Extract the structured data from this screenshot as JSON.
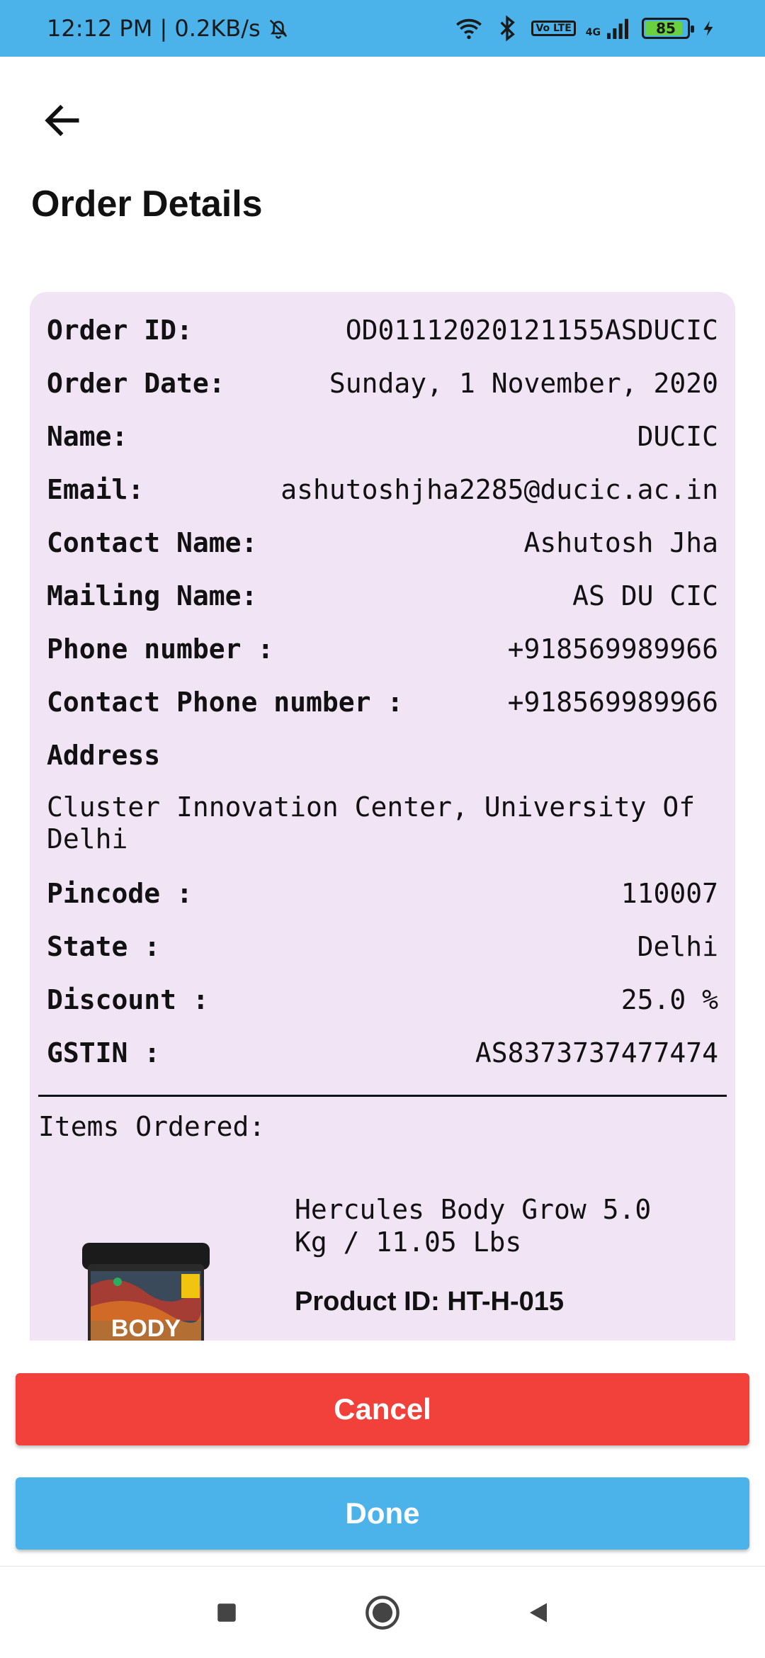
{
  "status_bar": {
    "time_speed": "12:12 PM | 0.2KB/s",
    "volte": "Vo LTE",
    "network": "4G",
    "battery": "85"
  },
  "header": {
    "title": "Order Details"
  },
  "order": {
    "rows_top": [
      {
        "label": "Order ID:",
        "value": "OD01112020121155ASDUCIC"
      },
      {
        "label": "Order Date:",
        "value": "Sunday, 1 November, 2020"
      },
      {
        "label": "Name:",
        "value": "DUCIC"
      },
      {
        "label": "Email:",
        "value": "ashutoshjha2285@ducic.ac.in"
      },
      {
        "label": "Contact Name:",
        "value": "Ashutosh Jha"
      },
      {
        "label": "Mailing Name:",
        "value": "AS DU CIC"
      },
      {
        "label": "Phone number :",
        "value": "+918569989966"
      },
      {
        "label": "Contact Phone number :",
        "value": "+918569989966"
      }
    ],
    "address_label": "Address",
    "address_value": "Cluster Innovation Center, University Of Delhi",
    "rows_bottom": [
      {
        "label": "Pincode :",
        "value": "110007"
      },
      {
        "label": "State :",
        "value": "Delhi"
      },
      {
        "label": "Discount :",
        "value": "25.0 %"
      },
      {
        "label": "GSTIN :",
        "value": "AS8373737477474"
      }
    ],
    "items_title": "Items Ordered:",
    "items": [
      {
        "name": "Hercules Body Grow 5.0 Kg / 11.05 Lbs",
        "product_id": "Product ID: HT-H-015",
        "image_text": "BODY"
      }
    ]
  },
  "buttons": {
    "cancel": "Cancel",
    "done": "Done"
  },
  "colors": {
    "accent": "#4bb3ea",
    "cancel": "#f2403a",
    "card_bg": "#f1e4f5"
  }
}
